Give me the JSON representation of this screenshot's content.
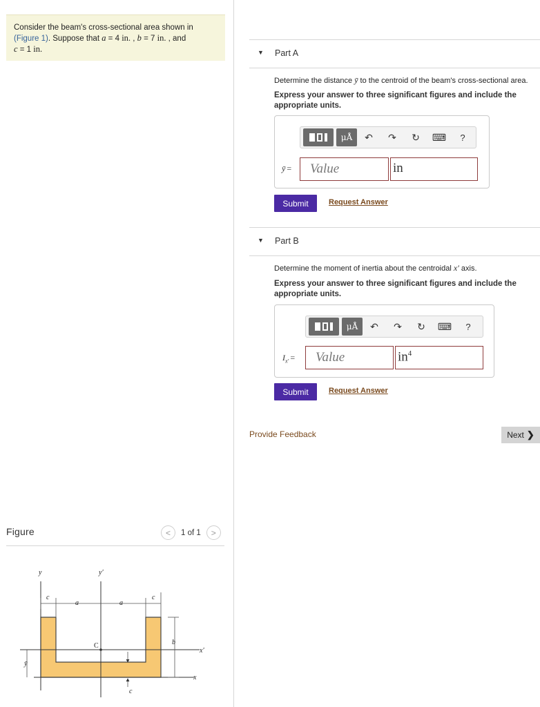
{
  "problem": {
    "line1": "Consider the beam's cross-sectional area shown in",
    "figure_link": "(Figure 1)",
    "suppose": ". Suppose that ",
    "a_var": "a",
    "a_val": " = 4 ",
    "a_unit": "in.",
    "b_sep": " , ",
    "b_var": "b",
    "b_val": " = 7 ",
    "b_unit": "in.",
    "and": " , and",
    "c_var": "c",
    "c_val": " = 1 ",
    "c_unit": "in."
  },
  "part_a": {
    "title": "Part A",
    "question_pre": "Determine the distance ",
    "question_var": "ȳ",
    "question_post": " to the centroid of the beam's cross-sectional area.",
    "instruction": "Express your answer to three significant figures and include the appropriate units.",
    "label_var": "ȳ",
    "label_eq": "=",
    "value_placeholder": "Value",
    "unit": "in",
    "submit": "Submit",
    "request": "Request Answer"
  },
  "part_b": {
    "title": "Part B",
    "question_pre": "Determine the moment of inertia about the centroidal ",
    "question_var": "x′",
    "question_post": " axis.",
    "instruction": "Express your answer to three significant figures and include the appropriate units.",
    "label_var": "I",
    "label_sub": "x′",
    "label_eq": "=",
    "value_placeholder": "Value",
    "unit": "in",
    "unit_exp": "4",
    "submit": "Submit",
    "request": "Request Answer"
  },
  "toolbar": {
    "mu": "μÅ",
    "help": "?"
  },
  "footer": {
    "feedback": "Provide Feedback",
    "next": "Next",
    "next_icon": "❯"
  },
  "figure": {
    "title": "Figure",
    "pager": "1 of 1",
    "prev": "<",
    "next": ">",
    "labels": {
      "y": "y",
      "y_prime": "y′",
      "c_left": "c",
      "a_left": "a",
      "a_right": "a",
      "c_right": "c",
      "b": "b",
      "C": "C",
      "x_prime": "x′",
      "y_bar": "ȳ",
      "x": "x",
      "c_bottom": "c"
    },
    "fill_color": "#f7c873"
  }
}
